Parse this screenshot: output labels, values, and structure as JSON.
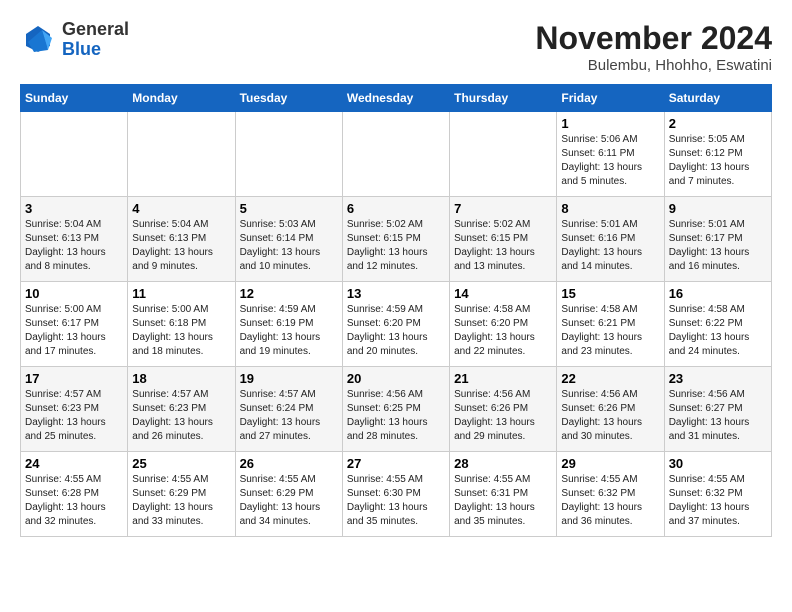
{
  "logo": {
    "general": "General",
    "blue": "Blue"
  },
  "title": "November 2024",
  "location": "Bulembu, Hhohho, Eswatini",
  "days_of_week": [
    "Sunday",
    "Monday",
    "Tuesday",
    "Wednesday",
    "Thursday",
    "Friday",
    "Saturday"
  ],
  "weeks": [
    [
      {
        "day": "",
        "info": ""
      },
      {
        "day": "",
        "info": ""
      },
      {
        "day": "",
        "info": ""
      },
      {
        "day": "",
        "info": ""
      },
      {
        "day": "",
        "info": ""
      },
      {
        "day": "1",
        "info": "Sunrise: 5:06 AM\nSunset: 6:11 PM\nDaylight: 13 hours and 5 minutes."
      },
      {
        "day": "2",
        "info": "Sunrise: 5:05 AM\nSunset: 6:12 PM\nDaylight: 13 hours and 7 minutes."
      }
    ],
    [
      {
        "day": "3",
        "info": "Sunrise: 5:04 AM\nSunset: 6:13 PM\nDaylight: 13 hours and 8 minutes."
      },
      {
        "day": "4",
        "info": "Sunrise: 5:04 AM\nSunset: 6:13 PM\nDaylight: 13 hours and 9 minutes."
      },
      {
        "day": "5",
        "info": "Sunrise: 5:03 AM\nSunset: 6:14 PM\nDaylight: 13 hours and 10 minutes."
      },
      {
        "day": "6",
        "info": "Sunrise: 5:02 AM\nSunset: 6:15 PM\nDaylight: 13 hours and 12 minutes."
      },
      {
        "day": "7",
        "info": "Sunrise: 5:02 AM\nSunset: 6:15 PM\nDaylight: 13 hours and 13 minutes."
      },
      {
        "day": "8",
        "info": "Sunrise: 5:01 AM\nSunset: 6:16 PM\nDaylight: 13 hours and 14 minutes."
      },
      {
        "day": "9",
        "info": "Sunrise: 5:01 AM\nSunset: 6:17 PM\nDaylight: 13 hours and 16 minutes."
      }
    ],
    [
      {
        "day": "10",
        "info": "Sunrise: 5:00 AM\nSunset: 6:17 PM\nDaylight: 13 hours and 17 minutes."
      },
      {
        "day": "11",
        "info": "Sunrise: 5:00 AM\nSunset: 6:18 PM\nDaylight: 13 hours and 18 minutes."
      },
      {
        "day": "12",
        "info": "Sunrise: 4:59 AM\nSunset: 6:19 PM\nDaylight: 13 hours and 19 minutes."
      },
      {
        "day": "13",
        "info": "Sunrise: 4:59 AM\nSunset: 6:20 PM\nDaylight: 13 hours and 20 minutes."
      },
      {
        "day": "14",
        "info": "Sunrise: 4:58 AM\nSunset: 6:20 PM\nDaylight: 13 hours and 22 minutes."
      },
      {
        "day": "15",
        "info": "Sunrise: 4:58 AM\nSunset: 6:21 PM\nDaylight: 13 hours and 23 minutes."
      },
      {
        "day": "16",
        "info": "Sunrise: 4:58 AM\nSunset: 6:22 PM\nDaylight: 13 hours and 24 minutes."
      }
    ],
    [
      {
        "day": "17",
        "info": "Sunrise: 4:57 AM\nSunset: 6:23 PM\nDaylight: 13 hours and 25 minutes."
      },
      {
        "day": "18",
        "info": "Sunrise: 4:57 AM\nSunset: 6:23 PM\nDaylight: 13 hours and 26 minutes."
      },
      {
        "day": "19",
        "info": "Sunrise: 4:57 AM\nSunset: 6:24 PM\nDaylight: 13 hours and 27 minutes."
      },
      {
        "day": "20",
        "info": "Sunrise: 4:56 AM\nSunset: 6:25 PM\nDaylight: 13 hours and 28 minutes."
      },
      {
        "day": "21",
        "info": "Sunrise: 4:56 AM\nSunset: 6:26 PM\nDaylight: 13 hours and 29 minutes."
      },
      {
        "day": "22",
        "info": "Sunrise: 4:56 AM\nSunset: 6:26 PM\nDaylight: 13 hours and 30 minutes."
      },
      {
        "day": "23",
        "info": "Sunrise: 4:56 AM\nSunset: 6:27 PM\nDaylight: 13 hours and 31 minutes."
      }
    ],
    [
      {
        "day": "24",
        "info": "Sunrise: 4:55 AM\nSunset: 6:28 PM\nDaylight: 13 hours and 32 minutes."
      },
      {
        "day": "25",
        "info": "Sunrise: 4:55 AM\nSunset: 6:29 PM\nDaylight: 13 hours and 33 minutes."
      },
      {
        "day": "26",
        "info": "Sunrise: 4:55 AM\nSunset: 6:29 PM\nDaylight: 13 hours and 34 minutes."
      },
      {
        "day": "27",
        "info": "Sunrise: 4:55 AM\nSunset: 6:30 PM\nDaylight: 13 hours and 35 minutes."
      },
      {
        "day": "28",
        "info": "Sunrise: 4:55 AM\nSunset: 6:31 PM\nDaylight: 13 hours and 35 minutes."
      },
      {
        "day": "29",
        "info": "Sunrise: 4:55 AM\nSunset: 6:32 PM\nDaylight: 13 hours and 36 minutes."
      },
      {
        "day": "30",
        "info": "Sunrise: 4:55 AM\nSunset: 6:32 PM\nDaylight: 13 hours and 37 minutes."
      }
    ]
  ]
}
